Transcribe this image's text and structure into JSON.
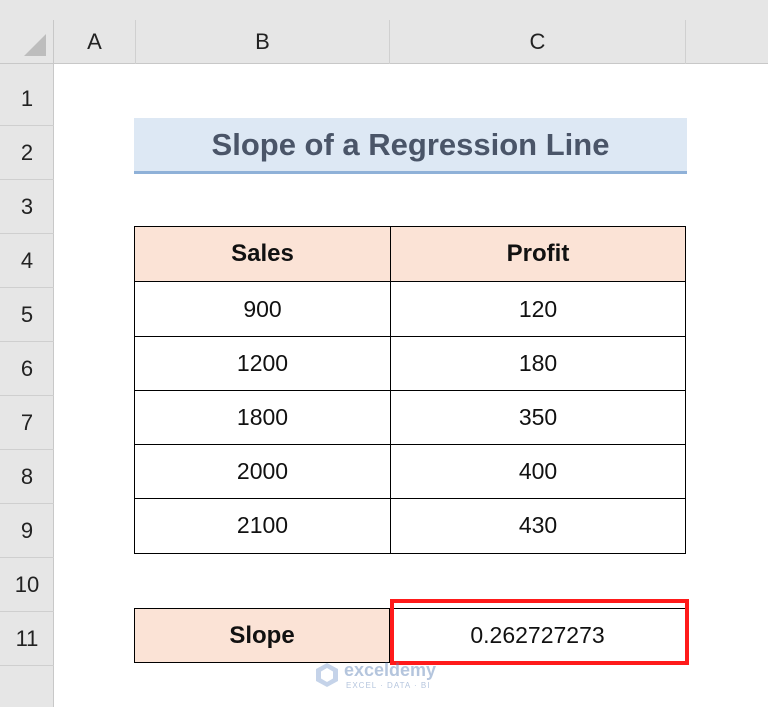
{
  "columns": [
    "A",
    "B",
    "C"
  ],
  "rows": [
    "1",
    "2",
    "3",
    "4",
    "5",
    "6",
    "7",
    "8",
    "9",
    "10",
    "11"
  ],
  "title": "Slope of a Regression Line",
  "table": {
    "headers": [
      "Sales",
      "Profit"
    ],
    "rows": [
      [
        "900",
        "120"
      ],
      [
        "1200",
        "180"
      ],
      [
        "1800",
        "350"
      ],
      [
        "2000",
        "400"
      ],
      [
        "2100",
        "430"
      ]
    ]
  },
  "slope": {
    "label": "Slope",
    "value": "0.262727273"
  },
  "watermark": {
    "brand": "exceldemy",
    "tagline": "EXCEL · DATA · BI"
  },
  "colors": {
    "header_fill": "#fbe3d6",
    "title_fill": "#dde8f4",
    "highlight": "#ff1a1a",
    "grid_header": "#e6e6e6"
  }
}
